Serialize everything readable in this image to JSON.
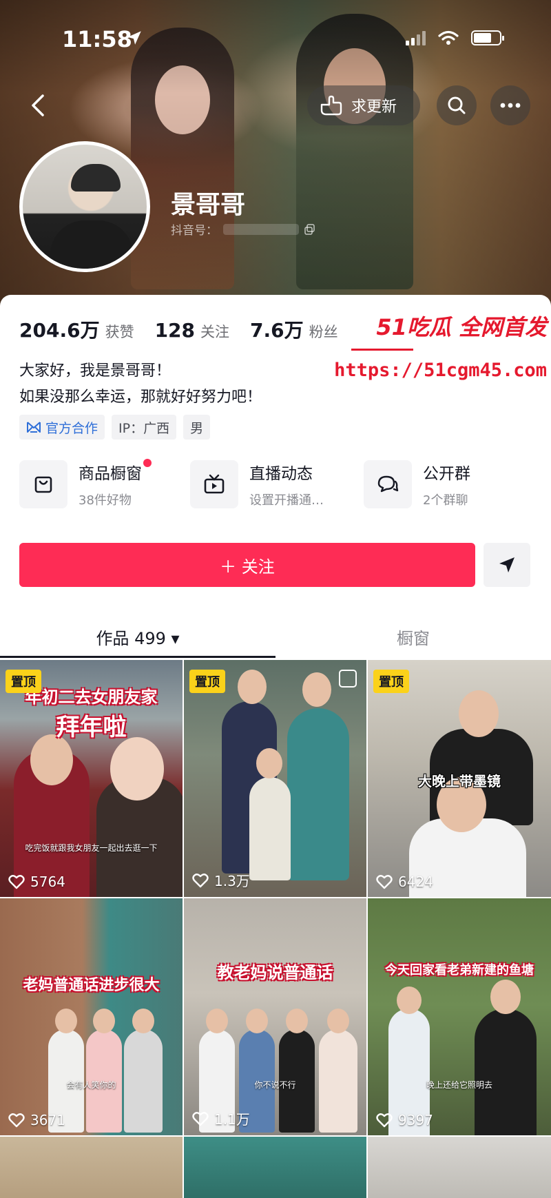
{
  "status_bar": {
    "time": "11:58"
  },
  "nav": {
    "update_label": "求更新"
  },
  "profile": {
    "nickname": "景哥哥",
    "id_label": "抖音号："
  },
  "stats": [
    {
      "num": "204.6万",
      "label": "获赞"
    },
    {
      "num": "128",
      "label": "关注"
    },
    {
      "num": "7.6万",
      "label": "粉丝"
    }
  ],
  "watermark": {
    "top": "51吃瓜 全网首发",
    "url": "https://51cgm45.com"
  },
  "bio": {
    "line1": "大家好，我是景哥哥！",
    "line2": "如果没那么幸运，那就好好努力吧！"
  },
  "tags": {
    "official": "官方合作",
    "ip": "IP：广西",
    "gender": "男"
  },
  "features": [
    {
      "title": "商品橱窗",
      "sub": "38件好物",
      "icon": "bag-icon",
      "dot": true
    },
    {
      "title": "直播动态",
      "sub": "设置开播通…",
      "icon": "tv-icon",
      "dot": false
    },
    {
      "title": "公开群",
      "sub": "2个群聊",
      "icon": "chat-icon",
      "dot": false
    }
  ],
  "follow_label": "＋ 关注",
  "tabs": {
    "works": "作品 499 ▾",
    "showcase": "橱窗"
  },
  "videos": [
    {
      "pinned": true,
      "pin_label": "置顶",
      "likes": "5764",
      "caption1": "年初二去女朋友家",
      "caption2": "拜年啦",
      "subtitle": "吃完饭就跟我女朋友一起出去逛一下"
    },
    {
      "pinned": true,
      "pin_label": "置顶",
      "likes": "1.3万"
    },
    {
      "pinned": true,
      "pin_label": "置顶",
      "likes": "6424",
      "caption1": "大晚上带墨镜"
    },
    {
      "likes": "3671",
      "caption1": "老妈普通话进步很大",
      "subtitle": "会有人笑你的"
    },
    {
      "likes": "1.1万",
      "caption1": "教老妈说普通话",
      "subtitle": "你不说不行"
    },
    {
      "likes": "9397",
      "caption1": "今天回家看老弟新建的鱼塘",
      "subtitle": "晚上还给它照明去"
    }
  ],
  "colors": {
    "brand_red": "#fe2c55",
    "pin_yellow": "#fbd21a",
    "watermark_red": "#e5192e"
  }
}
